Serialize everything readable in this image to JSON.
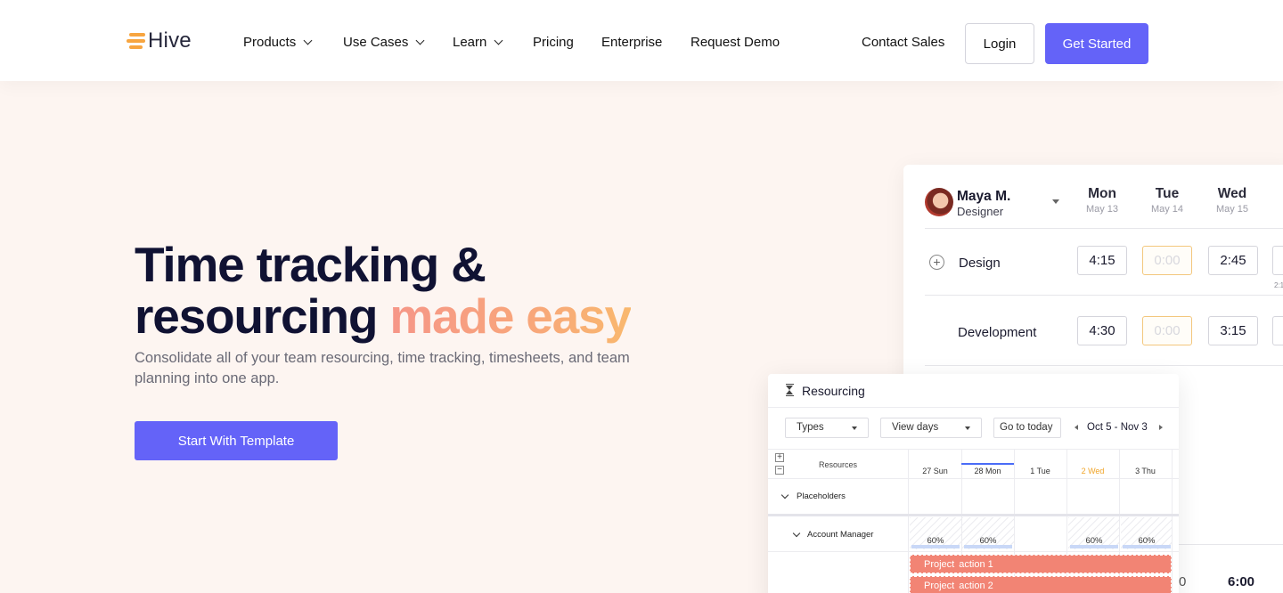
{
  "brand": {
    "name": "Hive",
    "logo_color": "#f7a540"
  },
  "nav": {
    "items": [
      {
        "label": "Products",
        "has_dropdown": true
      },
      {
        "label": "Use Cases",
        "has_dropdown": true
      },
      {
        "label": "Learn",
        "has_dropdown": true
      },
      {
        "label": "Pricing",
        "has_dropdown": false
      },
      {
        "label": "Enterprise",
        "has_dropdown": false
      },
      {
        "label": "Request Demo",
        "has_dropdown": false
      }
    ],
    "contact_sales": "Contact Sales",
    "login": "Login",
    "get_started": "Get Started"
  },
  "hero": {
    "title_line1": "Time tracking &",
    "title_line2_plain": "resourcing ",
    "title_line2_accent": "made easy",
    "subtitle": "Consolidate all of your team resourcing, time tracking, timesheets, and team planning into one app.",
    "cta": "Start With Template"
  },
  "timesheet": {
    "user_name": "Maya M.",
    "user_role": "Designer",
    "days": [
      {
        "day": "Mon",
        "date": "May 13"
      },
      {
        "day": "Tue",
        "date": "May 14"
      },
      {
        "day": "Wed",
        "date": "May 15"
      }
    ],
    "rows": [
      {
        "task": "Design",
        "values": [
          "4:15",
          "0:00",
          "2:45"
        ]
      },
      {
        "task": "Development",
        "values": [
          "4:30",
          "0:00",
          "3:15"
        ]
      }
    ],
    "partial_value": "2:1",
    "bottom_values": [
      "0",
      "6:00"
    ]
  },
  "resourcing": {
    "title": "Resourcing",
    "filters": {
      "types": "Types",
      "view": "View days",
      "today": "Go to today"
    },
    "date_range": "Oct 5 - Nov 3",
    "resources_label": "Resources",
    "dates": [
      "27 Sun",
      "28 Mon",
      "1 Tue",
      "2 Wed",
      "3 Thu"
    ],
    "groups": [
      {
        "label": "Placeholders"
      },
      {
        "label": "Account Manager",
        "allocations": [
          "60%",
          "60%",
          "",
          "60%",
          "60%"
        ]
      }
    ],
    "tasks": [
      {
        "project": "Project",
        "action": "action 1"
      },
      {
        "project": "Project",
        "action": "action 2"
      }
    ]
  },
  "colors": {
    "primary": "#6463f8",
    "hero_bg": "#fdf5f1",
    "accent_gradient_start": "#f69688",
    "accent_gradient_end": "#f9b86e",
    "task_bar": "#f28474",
    "today": "#f0a52a"
  }
}
